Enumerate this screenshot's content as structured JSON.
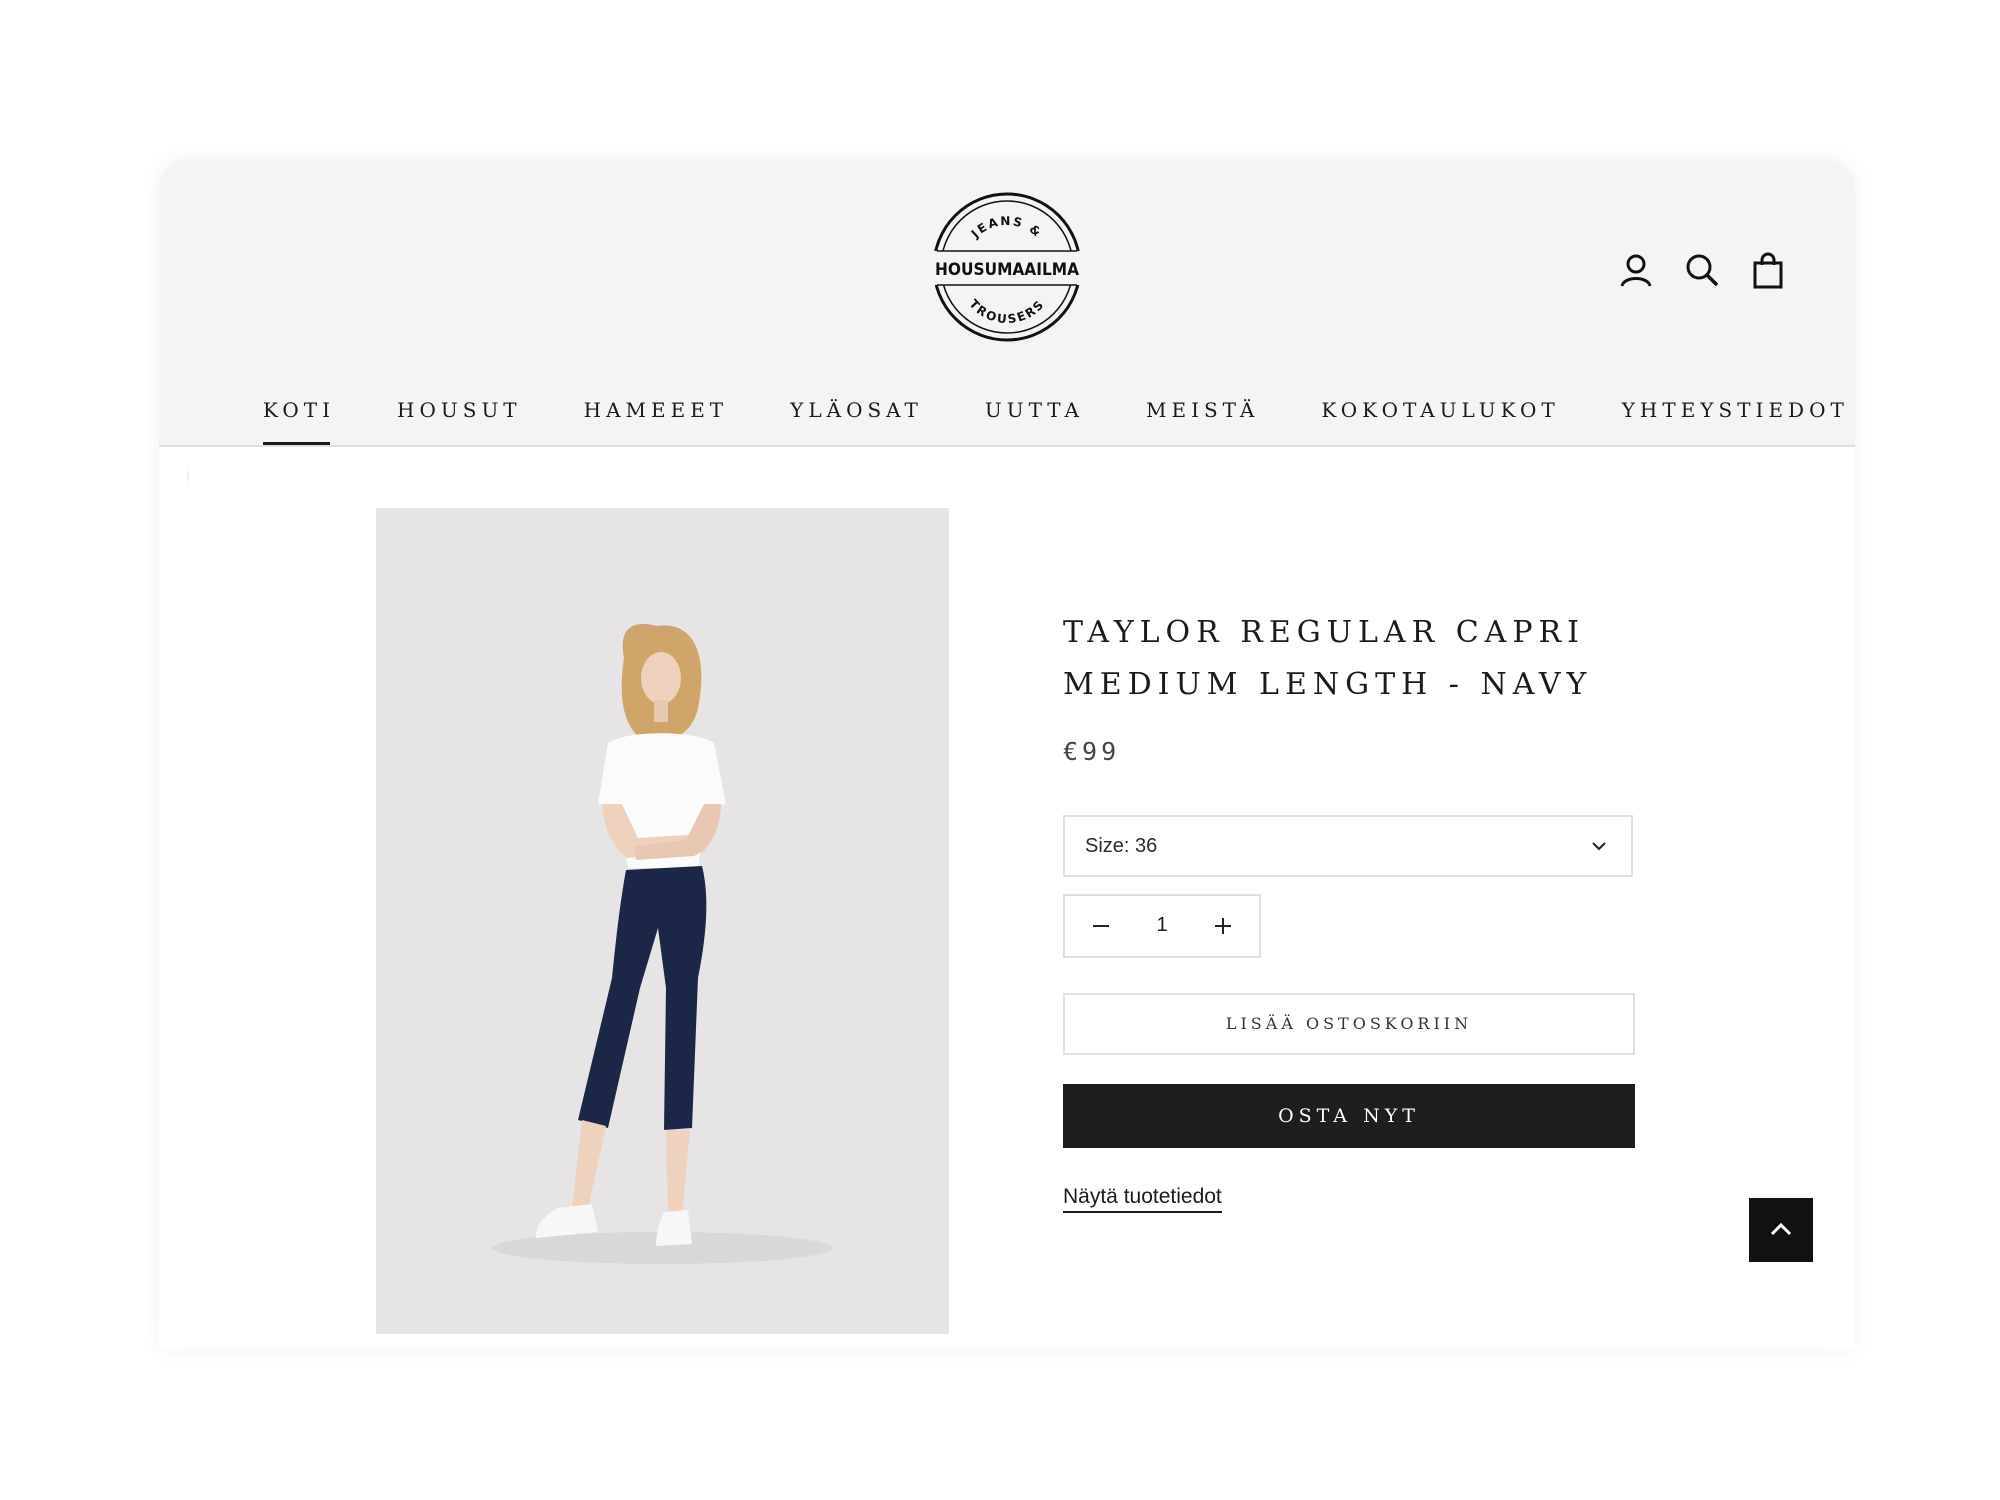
{
  "brand": {
    "name": "HOUSUMAAILMA",
    "ring_top": "JEANS &",
    "ring_bottom": "TROUSERS"
  },
  "header_icons": [
    "account-icon",
    "search-icon",
    "cart-bag-icon"
  ],
  "nav": {
    "items": [
      {
        "label": "KOTI",
        "active": true
      },
      {
        "label": "HOUSUT",
        "active": false
      },
      {
        "label": "HAMEEET",
        "active": false
      },
      {
        "label": "YLÄOSAT",
        "active": false
      },
      {
        "label": "UUTTA",
        "active": false
      },
      {
        "label": "MEISTÄ",
        "active": false
      },
      {
        "label": "KOKOTAULUKOT",
        "active": false
      },
      {
        "label": "YHTEYSTIEDOT",
        "active": false
      }
    ]
  },
  "product": {
    "title_line1": "TAYLOR REGULAR CAPRI",
    "title_line2": "MEDIUM LENGTH - NAVY",
    "price": "€99",
    "size_label": "Size: 36",
    "quantity": "1",
    "add_to_cart": "LISÄÄ OSTOSKORIIN",
    "buy_now": "OSTA NYT",
    "details_link": "Näytä tuotetiedot"
  },
  "colors": {
    "header_bg": "#f5f4f4",
    "text": "#1b1b1b",
    "buy_button_bg": "#1e1e1e",
    "pants_navy": "#1c2747",
    "photo_bg": "#e6e4e5"
  }
}
